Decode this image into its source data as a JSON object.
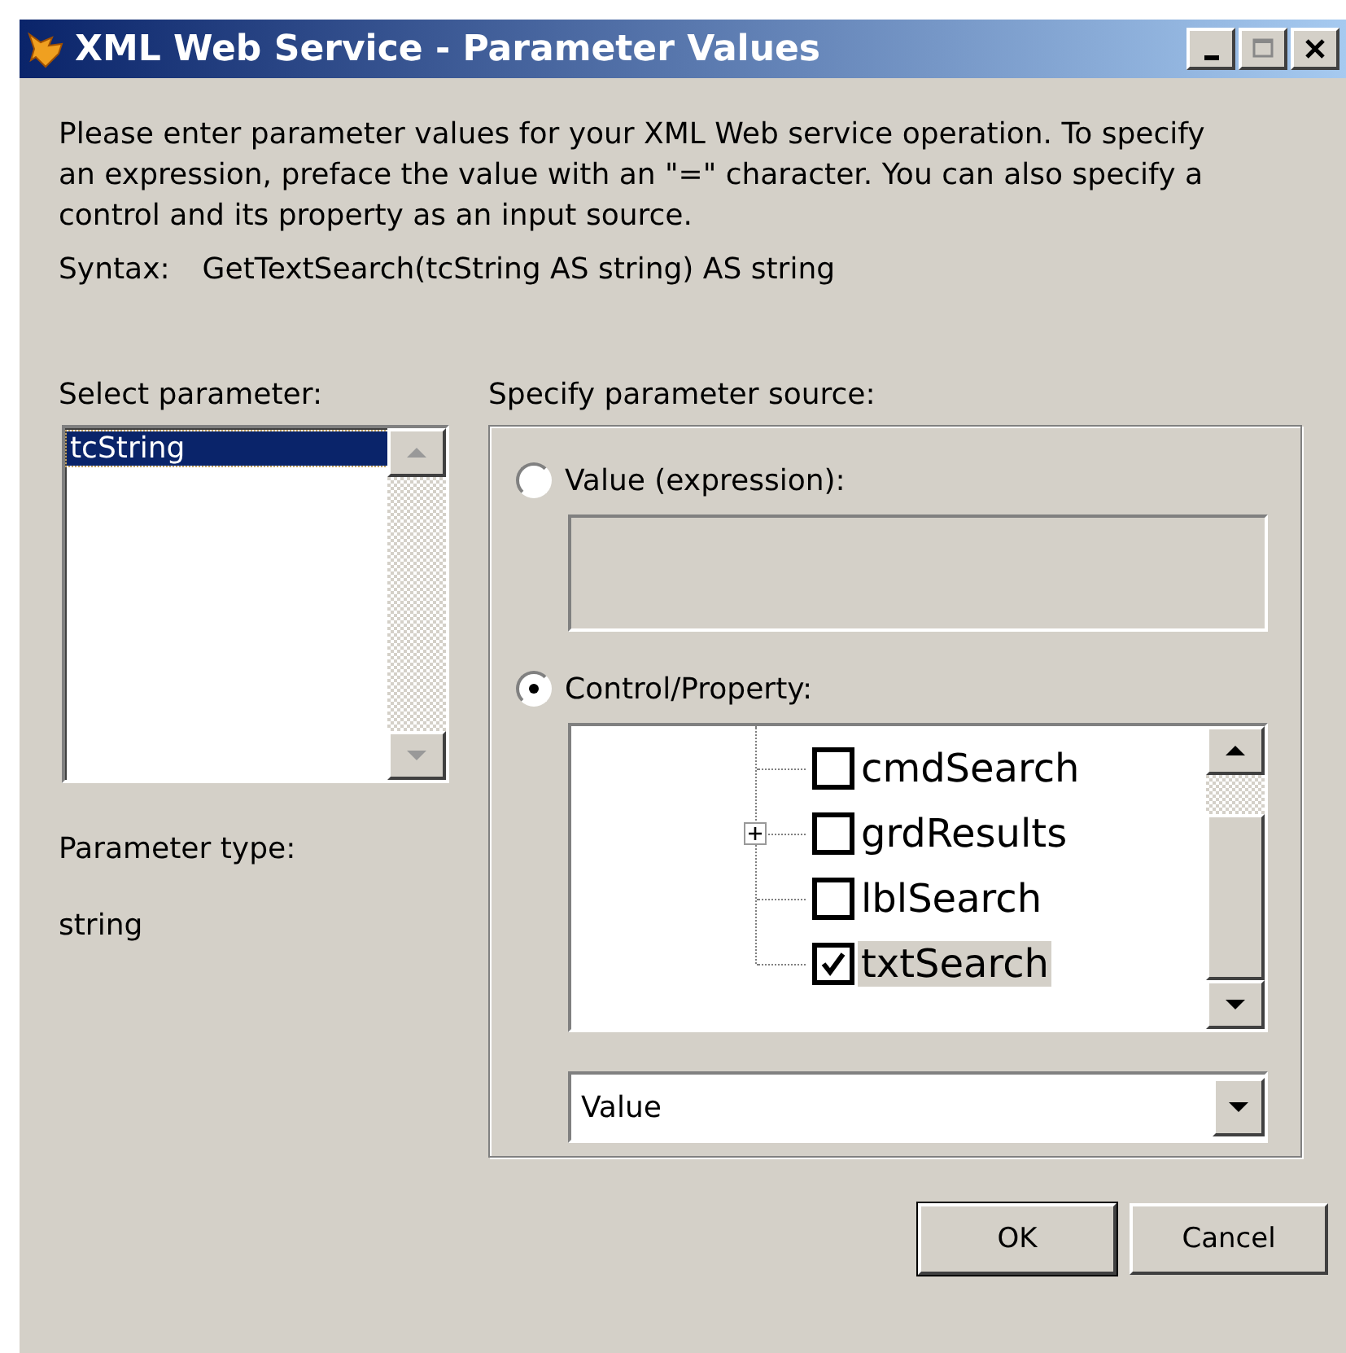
{
  "window": {
    "title": "XML Web Service - Parameter Values"
  },
  "intro": "Please enter parameter values for your XML Web service operation. To specify an expression, preface the value with an \"=\" character. You can also specify a control and its property as an input source.",
  "syntax": {
    "label": "Syntax:",
    "value": "GetTextSearch(tcString AS string) AS string"
  },
  "parameters": {
    "label": "Select parameter:",
    "items": [
      {
        "name": "tcString",
        "selected": true
      }
    ]
  },
  "parameter_type": {
    "label": "Parameter type:",
    "value": "string"
  },
  "source": {
    "label": "Specify parameter source:",
    "options": [
      {
        "label": "Value (expression):",
        "selected": false
      },
      {
        "label": "Control/Property:",
        "selected": true
      }
    ],
    "tree": [
      {
        "name": "cmdSearch",
        "checked": false,
        "selected": false,
        "expandable": false
      },
      {
        "name": "grdResults",
        "checked": false,
        "selected": false,
        "expandable": true
      },
      {
        "name": "lblSearch",
        "checked": false,
        "selected": false,
        "expandable": false
      },
      {
        "name": "txtSearch",
        "checked": true,
        "selected": true,
        "expandable": false
      }
    ],
    "property": "Value"
  },
  "buttons": [
    {
      "label": "OK",
      "default": true
    },
    {
      "label": "Cancel",
      "default": false
    }
  ]
}
